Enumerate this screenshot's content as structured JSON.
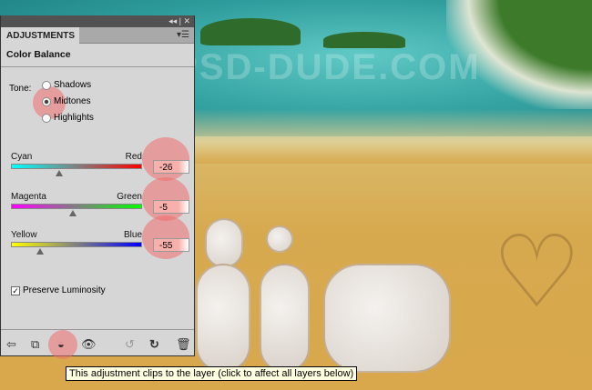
{
  "watermark": "WWW.PSD-DUDE.COM",
  "panel": {
    "tab": "ADJUSTMENTS",
    "title": "Color Balance",
    "tone_label": "Tone:",
    "tones": [
      {
        "label": "Shadows",
        "selected": false
      },
      {
        "label": "Midtones",
        "selected": true
      },
      {
        "label": "Highlights",
        "selected": false
      }
    ],
    "sliders": [
      {
        "left": "Cyan",
        "right": "Red",
        "value": "-26",
        "num": -26,
        "gradient": "linear-gradient(90deg,#00ffff,#ff0000)"
      },
      {
        "left": "Magenta",
        "right": "Green",
        "value": "-5",
        "num": -5,
        "gradient": "linear-gradient(90deg,#ff00ff,#00ff00)"
      },
      {
        "left": "Yellow",
        "right": "Blue",
        "value": "-55",
        "num": -55,
        "gradient": "linear-gradient(90deg,#ffff00,#0000ff)"
      }
    ],
    "preserve_luminosity": {
      "label": "Preserve Luminosity",
      "checked": true
    }
  },
  "tooltip": "This adjustment clips to the layer (click to affect all layers below)"
}
